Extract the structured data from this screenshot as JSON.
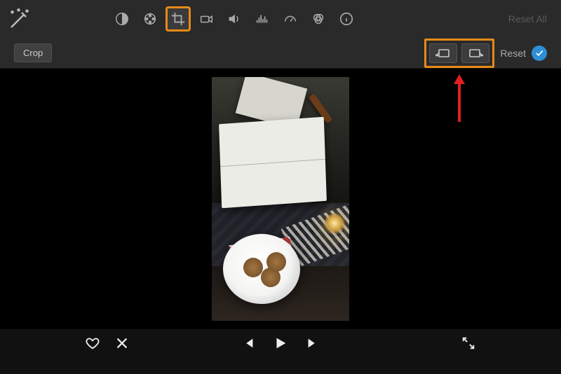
{
  "toolbar": {
    "reset_all_label": "Reset All"
  },
  "crop_bar": {
    "crop_label": "Crop",
    "reset_label": "Reset"
  },
  "icons": {
    "wand": "auto-enhance-icon",
    "balance": "color-balance-icon",
    "palette": "color-correction-icon",
    "crop": "crop-icon",
    "camera": "stabilization-icon",
    "volume": "volume-icon",
    "equalizer": "noise-reduction-icon",
    "speed": "speed-icon",
    "filters": "color-filters-icon",
    "info": "info-icon",
    "rotate_ccw": "rotate-counterclockwise-icon",
    "rotate_cw": "rotate-clockwise-icon",
    "heart": "favorite-icon",
    "reject": "reject-icon",
    "prev": "previous-frame-icon",
    "play": "play-icon",
    "next": "next-frame-icon",
    "fullscreen": "fullscreen-icon",
    "check": "apply-check-icon"
  },
  "highlight_color": "#e58a17",
  "arrow_color": "#e02020"
}
